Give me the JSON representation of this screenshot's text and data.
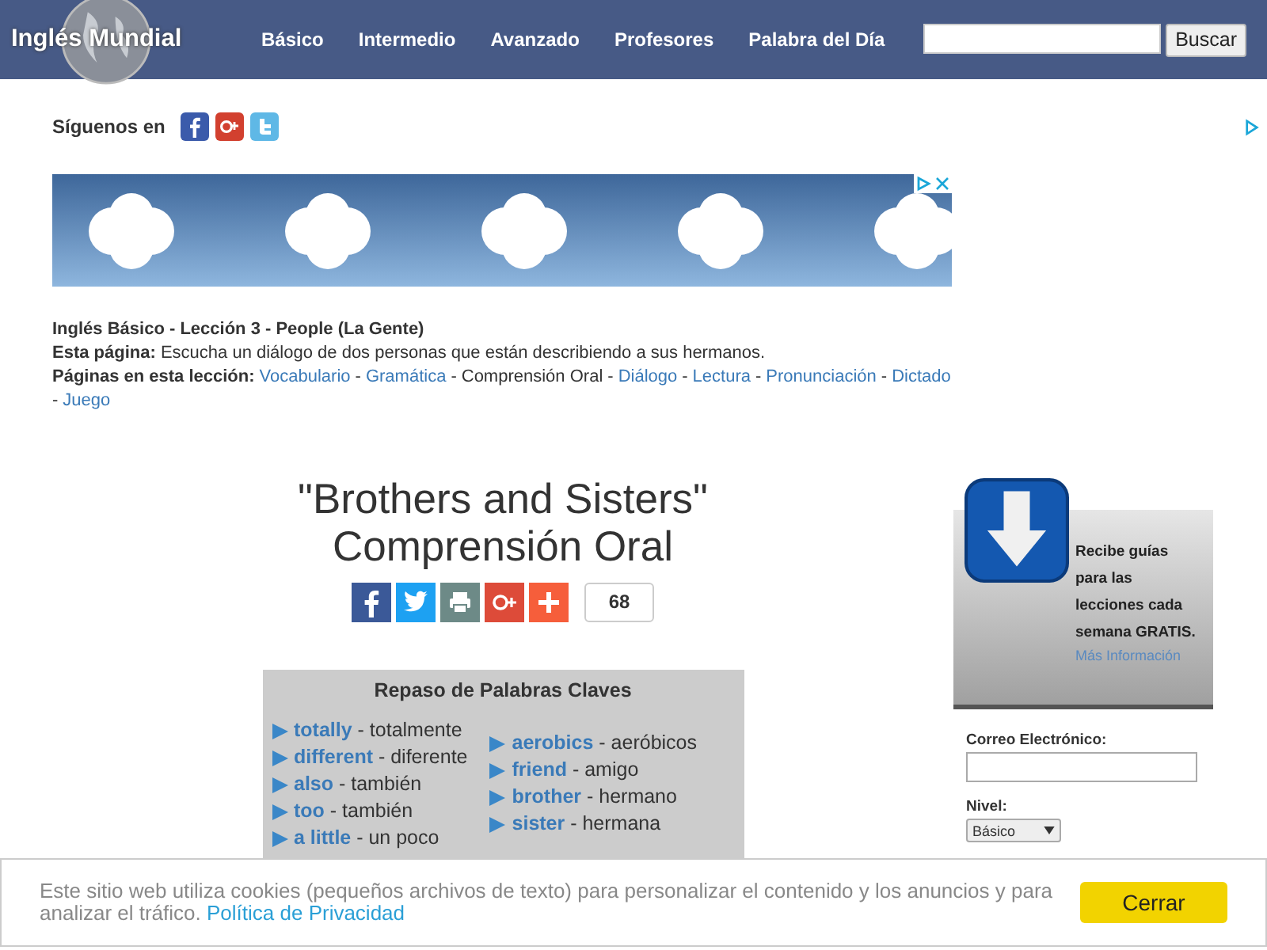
{
  "header": {
    "logo": "Inglés Mundial",
    "nav": [
      {
        "label": "Básico"
      },
      {
        "label": "Intermedio"
      },
      {
        "label": "Avanzado"
      },
      {
        "label": "Profesores"
      },
      {
        "label": "Palabra del Día"
      }
    ],
    "search": {
      "button": "Buscar"
    }
  },
  "follow": {
    "label": "Síguenos en"
  },
  "lesson": {
    "title": "Inglés Básico - Lección 3 - People (La Gente)",
    "page_label": "Esta página:",
    "page_text": "Escucha un diálogo de dos personas que están describiendo a sus hermanos.",
    "pages_label": "Páginas en esta lección:",
    "pages": [
      {
        "label": "Vocabulario",
        "selected": false,
        "separator": "-"
      },
      {
        "label": "Gramática",
        "selected": false,
        "separator": "-"
      },
      {
        "label": "Comprensión Oral",
        "selected": true,
        "separator": "-"
      },
      {
        "label": "Diálogo",
        "selected": false,
        "separator": "-"
      },
      {
        "label": "Lectura",
        "selected": false,
        "separator": "-"
      },
      {
        "label": "Pronunciación",
        "selected": false,
        "separator": "-"
      },
      {
        "label": "Dictado",
        "selected": false,
        "separator": "-"
      },
      {
        "label": "Juego",
        "selected": false
      }
    ]
  },
  "heading": {
    "line1": "\"Brothers and Sisters\"",
    "line2": "Comprensión Oral"
  },
  "share": {
    "count": "68"
  },
  "keywords": {
    "title": "Repaso de Palabras Claves",
    "columns": [
      [
        {
          "entry": "**totally** - totalmente"
        },
        {
          "entry": "**different** - diferente"
        },
        {
          "entry": "**also** - también"
        },
        {
          "entry": "**too** - también"
        },
        {
          "entry": "**a little** - un poco"
        }
      ],
      [
        {
          "entry": "**aerobics** - aeróbicos"
        },
        {
          "entry": "**friend** - amigo"
        },
        {
          "entry": "**brother** - hermano"
        },
        {
          "entry": "**sister** - hermana"
        }
      ]
    ]
  },
  "sidebar": {
    "promo": "Recibe guías para las lecciones cada semana GRATIS.",
    "more": "Más Información",
    "email_label": "Correo Electrónico:",
    "level_label": "Nivel:",
    "level_value": "Básico"
  },
  "cookie_banner": {
    "text": "Este sitio web utiliza cookies (pequeños archivos de texto) para personalizar el contenido y los anuncios y para analizar el tráfico.",
    "link": "Política de Privacidad",
    "button": "Cerrar"
  }
}
